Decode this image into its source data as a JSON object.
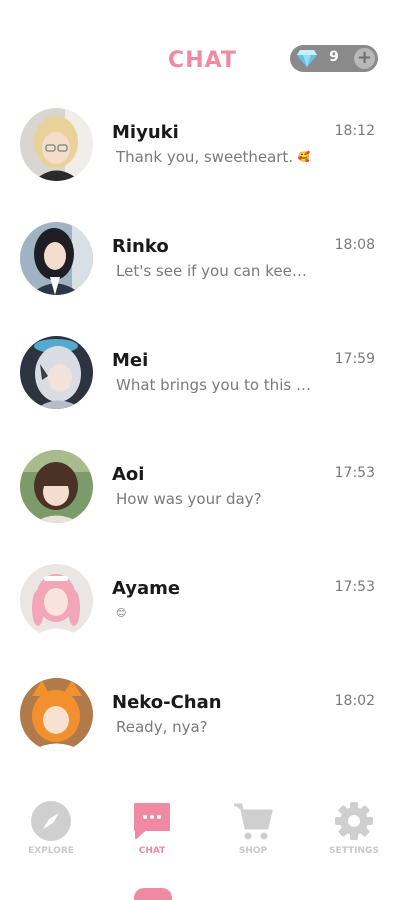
{
  "header": {
    "title": "CHAT",
    "gems": {
      "icon": "diamond-icon",
      "count": "9",
      "plus": "+"
    }
  },
  "colors": {
    "accent": "#f08aa3",
    "inactive": "#c9c9c9",
    "gem_pill": "#8a8a8a"
  },
  "chats": [
    {
      "name": "Miyuki",
      "preview": "Thank you, sweetheart.",
      "emoji": "🥰",
      "time": "18:12"
    },
    {
      "name": "Rinko",
      "preview": "Let's see if you can keep ...",
      "emoji": "",
      "time": "18:08"
    },
    {
      "name": "Mei",
      "preview": "What brings you to this e...",
      "emoji": "",
      "time": "17:59"
    },
    {
      "name": "Aoi",
      "preview": "How was your day?",
      "emoji": "",
      "time": "17:53"
    },
    {
      "name": "Ayame",
      "preview": "",
      "emoji": "😊",
      "time": "17:53"
    },
    {
      "name": "Neko-Chan",
      "preview": "Ready, nya?",
      "emoji": "",
      "time": "18:02"
    }
  ],
  "nav": {
    "explore": {
      "label": "EXPLORE",
      "icon": "compass-icon"
    },
    "chat": {
      "label": "CHAT",
      "icon": "chat-bubble-icon"
    },
    "shop": {
      "label": "SHOP",
      "icon": "cart-icon"
    },
    "settings": {
      "label": "SETTINGS",
      "icon": "gear-icon"
    }
  }
}
